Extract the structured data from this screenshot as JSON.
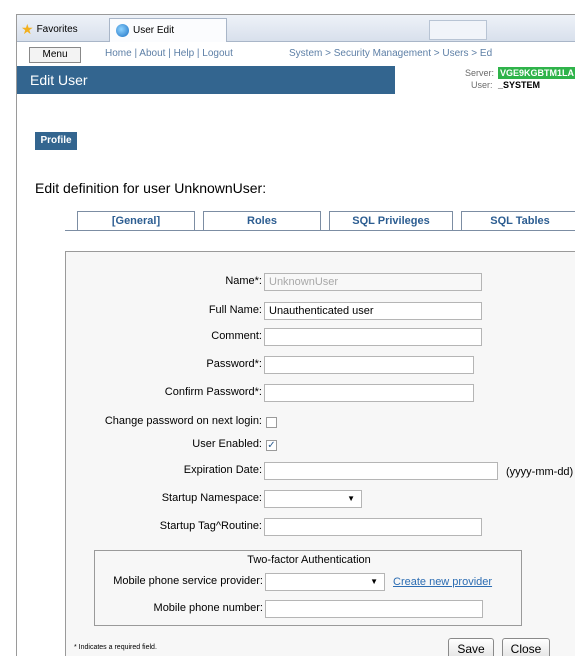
{
  "browser": {
    "favorites_label": "Favorites",
    "tab_title": "User Edit"
  },
  "header": {
    "menu_label": "Menu",
    "links": "Home | About | Help | Logout",
    "breadcrumb": "System > Security Management > Users > Ed",
    "page_title": "Edit User",
    "server_label": "Server:",
    "server_value": "VGE9KGBTM1LA",
    "user_label": "User:",
    "user_value": "_SYSTEM"
  },
  "profile_button": "Profile",
  "heading": "Edit definition for user UnknownUser:",
  "tabs": [
    "[General]",
    "Roles",
    "SQL Privileges",
    "SQL Tables"
  ],
  "form": {
    "name_label": "Name*:",
    "name_value": "UnknownUser",
    "fullname_label": "Full Name:",
    "fullname_value": "Unauthenticated user",
    "comment_label": "Comment:",
    "comment_value": "",
    "password_label": "Password*:",
    "confirm_label": "Confirm Password*:",
    "change_pw_label": "Change password on next login:",
    "change_pw_checked": false,
    "enabled_label": "User Enabled:",
    "enabled_checked": true,
    "expiration_label": "Expiration Date:",
    "expiration_hint": "(yyyy-mm-dd)",
    "namespace_label": "Startup Namespace:",
    "namespace_value": "",
    "tag_label": "Startup Tag^Routine:",
    "tag_value": ""
  },
  "two_factor": {
    "title": "Two-factor Authentication",
    "provider_label": "Mobile phone service provider:",
    "provider_value": "",
    "create_link": "Create new provider",
    "phone_label": "Mobile phone number:",
    "phone_value": ""
  },
  "footer": {
    "required_note": "* Indicates a required field.",
    "save_label": "Save",
    "close_label": "Close"
  },
  "colors": {
    "title_bar": "#33658f",
    "server_badge": "#2fb34a",
    "tab_text": "#2c5d91"
  }
}
